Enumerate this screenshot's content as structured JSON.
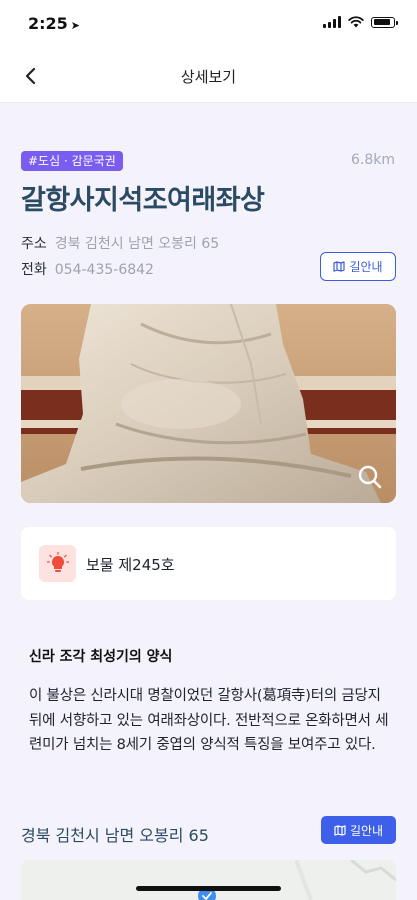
{
  "status_bar": {
    "time": "2:25"
  },
  "nav": {
    "title": "상세보기"
  },
  "place": {
    "tag": "#도심 · 감문국권",
    "distance": "6.8km",
    "name": "갈항사지석조여래좌상",
    "address_label": "주소",
    "address": "경북 김천시 남면 오봉리 65",
    "phone_label": "전화",
    "phone": "054-435-6842"
  },
  "route_button": {
    "label": "길안내"
  },
  "heritage": {
    "designation": "보물 제245호"
  },
  "section": {
    "title": "신라 조각 최성기의 양식",
    "description": "이 불상은 신라시대 명찰이었던 갈항사(葛項寺)터의 금당지 뒤에 서향하고 있는 여래좌상이다. 전반적으로 온화하면서 세련미가 넘치는 8세기 중엽의 양식적 특징을 보여주고 있다."
  },
  "bottom": {
    "address": "경북 김천시 남면 오봉리 65",
    "route_label": "길안내"
  },
  "colors": {
    "accent": "#3d5fea",
    "tag": "#7b5cf0",
    "title": "#2b4a63",
    "background": "#f4f3fb"
  },
  "icons": [
    "location-arrow-icon",
    "signal-icon",
    "wifi-icon",
    "battery-icon",
    "back-chevron-icon",
    "map-icon",
    "zoom-icon",
    "lightbulb-icon"
  ]
}
